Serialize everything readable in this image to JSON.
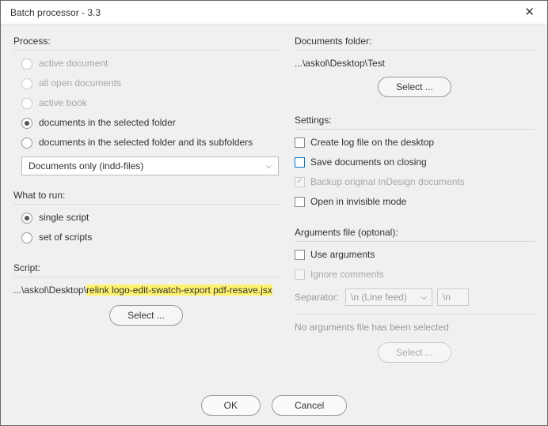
{
  "window": {
    "title": "Batch processor - 3.3"
  },
  "process": {
    "title": "Process:",
    "opt_active_document": "active document",
    "opt_all_open_documents": "all open documents",
    "opt_active_book": "active book",
    "opt_selected_folder": "documents in the selected folder",
    "opt_selected_folder_subfolders": "documents in the selected folder and its subfolders",
    "filter_select": "Documents only (indd-files)"
  },
  "what_to_run": {
    "title": "What to run:",
    "opt_single_script": "single script",
    "opt_set_of_scripts": "set of scripts"
  },
  "script": {
    "title": "Script:",
    "path_prefix": "...\\askol\\Desktop\\",
    "path_highlight": "relink logo-edit-swatch-export pdf-resave.jsx",
    "select_btn": "Select ..."
  },
  "documents_folder": {
    "title": "Documents folder:",
    "path": "...\\askol\\Desktop\\Test",
    "select_btn": "Select ..."
  },
  "settings": {
    "title": "Settings:",
    "create_log": "Create log file on the desktop",
    "save_on_close": "Save documents on closing",
    "backup": "Backup original InDesign documents",
    "invisible_mode": "Open in invisible mode"
  },
  "arguments": {
    "title": "Arguments file (optonal):",
    "use_args": "Use arguments",
    "ignore_comments": "Ignore comments",
    "separator_label": "Separator:",
    "separator_value": "\\n (Line feed)",
    "separator_literal": "\\n",
    "no_file_msg": "No arguments file has been selected",
    "select_btn": "Select ..."
  },
  "footer": {
    "ok": "OK",
    "cancel": "Cancel"
  }
}
